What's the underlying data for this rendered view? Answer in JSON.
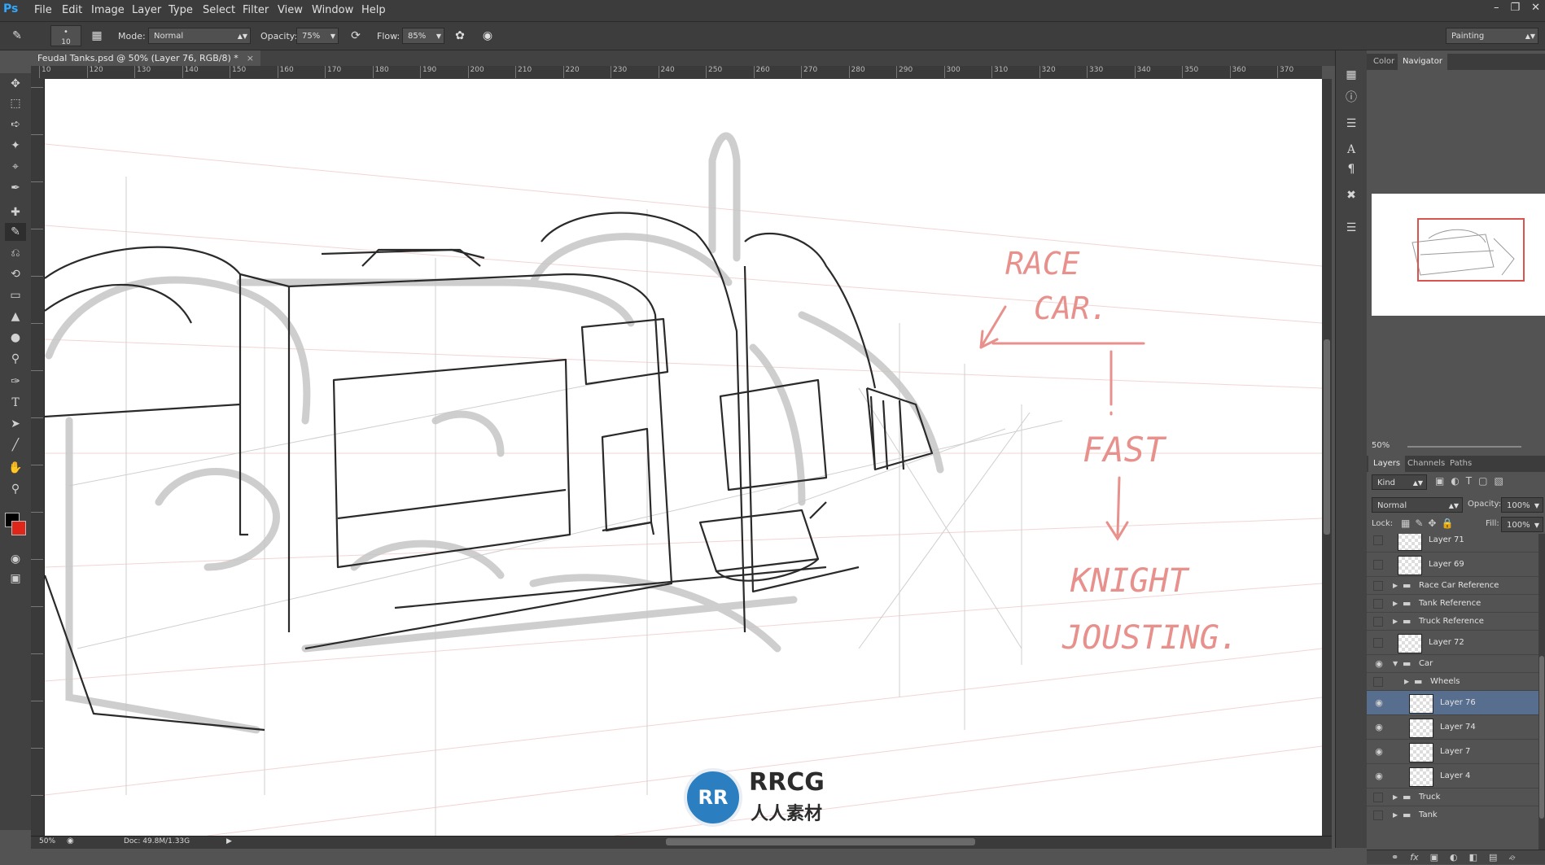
{
  "app": {
    "logo": "Ps"
  },
  "menu": [
    "File",
    "Edit",
    "Image",
    "Layer",
    "Type",
    "Select",
    "Filter",
    "View",
    "Window",
    "Help"
  ],
  "options_bar": {
    "brush_size": "10",
    "mode_label": "Mode:",
    "mode_value": "Normal",
    "opacity_label": "Opacity:",
    "opacity_value": "75%",
    "flow_label": "Flow:",
    "flow_value": "85%",
    "workspace": "Painting"
  },
  "document": {
    "tab_title": "Feudal Tanks.psd @ 50% (Layer 76, RGB/8) *",
    "close": "×"
  },
  "ruler": {
    "h_labels": [
      "10",
      "120",
      "130",
      "140",
      "150",
      "160",
      "170",
      "180",
      "190",
      "200",
      "210",
      "220",
      "230",
      "240",
      "250",
      "260",
      "270",
      "280",
      "290",
      "300",
      "310",
      "320",
      "330",
      "340",
      "350",
      "360",
      "370"
    ]
  },
  "status": {
    "zoom": "50%",
    "doc": "Doc: 49.8M/1.33G"
  },
  "sketch_annotations": {
    "race_car": [
      "RACE",
      "CAR."
    ],
    "fast": "FAST",
    "knight": "KNIGHT",
    "jousting": "JOUSTING.",
    "ink_color": "#e8918c"
  },
  "navigator": {
    "tabs": [
      "Color",
      "Navigator"
    ],
    "active_tab": "Navigator",
    "zoom": "50%"
  },
  "layers_panel": {
    "tabs": [
      "Layers",
      "Channels",
      "Paths"
    ],
    "active_tab": "Layers",
    "filter_kind": "Kind",
    "blend_mode": "Normal",
    "opacity_label": "Opacity:",
    "opacity_value": "100%",
    "lock_label": "Lock:",
    "fill_label": "Fill:",
    "fill_value": "100%",
    "rows": [
      {
        "name": "Layer 71",
        "type": "layer",
        "visible": false,
        "indent": 0
      },
      {
        "name": "Layer 69",
        "type": "layer",
        "visible": false,
        "indent": 0
      },
      {
        "name": "Race Car Reference",
        "type": "group",
        "visible": false,
        "indent": 0,
        "open": false
      },
      {
        "name": "Tank Reference",
        "type": "group",
        "visible": false,
        "indent": 0,
        "open": false
      },
      {
        "name": "Truck Reference",
        "type": "group",
        "visible": false,
        "indent": 0,
        "open": false
      },
      {
        "name": "Layer 72",
        "type": "layer",
        "visible": false,
        "indent": 0
      },
      {
        "name": "Car",
        "type": "group",
        "visible": true,
        "indent": 0,
        "open": true
      },
      {
        "name": "Wheels",
        "type": "group",
        "visible": false,
        "indent": 1,
        "open": false
      },
      {
        "name": "Layer 76",
        "type": "layer",
        "visible": true,
        "indent": 1,
        "selected": true
      },
      {
        "name": "Layer 74",
        "type": "layer",
        "visible": true,
        "indent": 1
      },
      {
        "name": "Layer 7",
        "type": "layer",
        "visible": true,
        "indent": 1
      },
      {
        "name": "Layer 4",
        "type": "layer",
        "visible": true,
        "indent": 1
      },
      {
        "name": "Truck",
        "type": "group",
        "visible": false,
        "indent": 0,
        "open": false
      },
      {
        "name": "Tank",
        "type": "group",
        "visible": false,
        "indent": 0,
        "open": false
      }
    ],
    "footer_icons": [
      "link-icon",
      "fx-icon",
      "mask-icon",
      "adjustment-icon",
      "folder-icon",
      "new-layer-icon",
      "trash-icon"
    ]
  },
  "watermark": {
    "badge": "RR",
    "name": "RRCG",
    "sub": "人人素材"
  },
  "colors": {
    "foreground": "#000000",
    "background": "#e0261b",
    "accent_selected": "#586e8f"
  }
}
